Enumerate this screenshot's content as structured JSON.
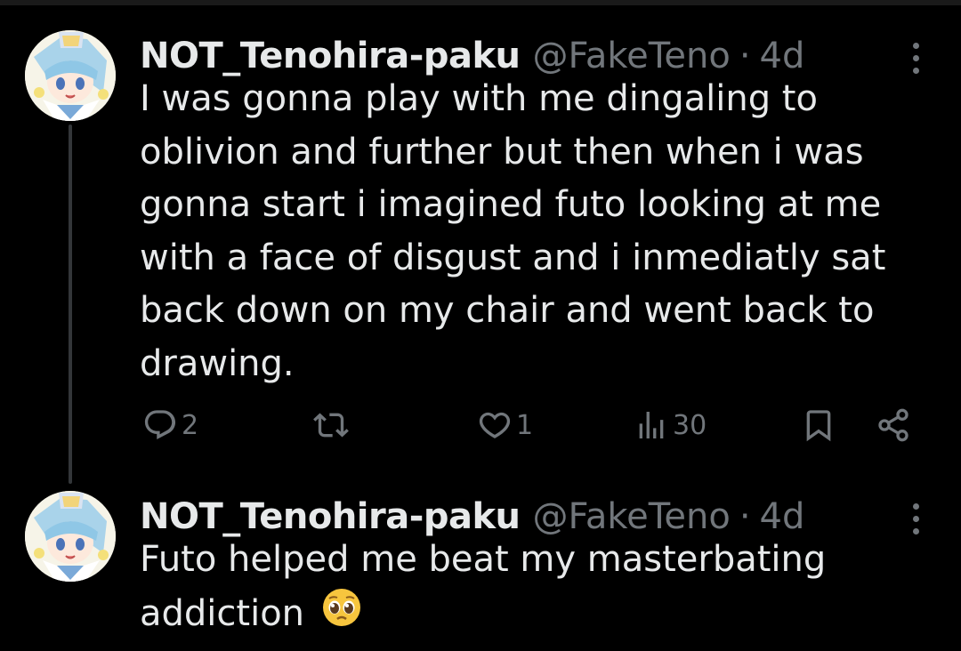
{
  "tweets": [
    {
      "display_name": "NOT_Tenohira-paku",
      "handle": "@FakeTeno",
      "separator": "·",
      "time": "4d",
      "text": "I was gonna play with me dingaling to oblivion and further but then when i was gonna start i imagined futo looking at me with a face of disgust and i inmediatly sat back down on my chair and went back to drawing.",
      "avatar_icon": "anime-avatar-icon",
      "actions": {
        "reply_count": "2",
        "retweet_count": "",
        "like_count": "1",
        "views_count": "30"
      }
    },
    {
      "display_name": "NOT_Tenohira-paku",
      "handle": "@FakeTeno",
      "separator": "·",
      "time": "4d",
      "text": "Futo helped me beat my masterbating addiction",
      "emoji": "pleading-face-emoji",
      "avatar_icon": "anime-avatar-icon"
    }
  ],
  "colors": {
    "background": "#000000",
    "text": "#e7e9ea",
    "secondary": "#71767b",
    "thread_line": "#333639"
  }
}
